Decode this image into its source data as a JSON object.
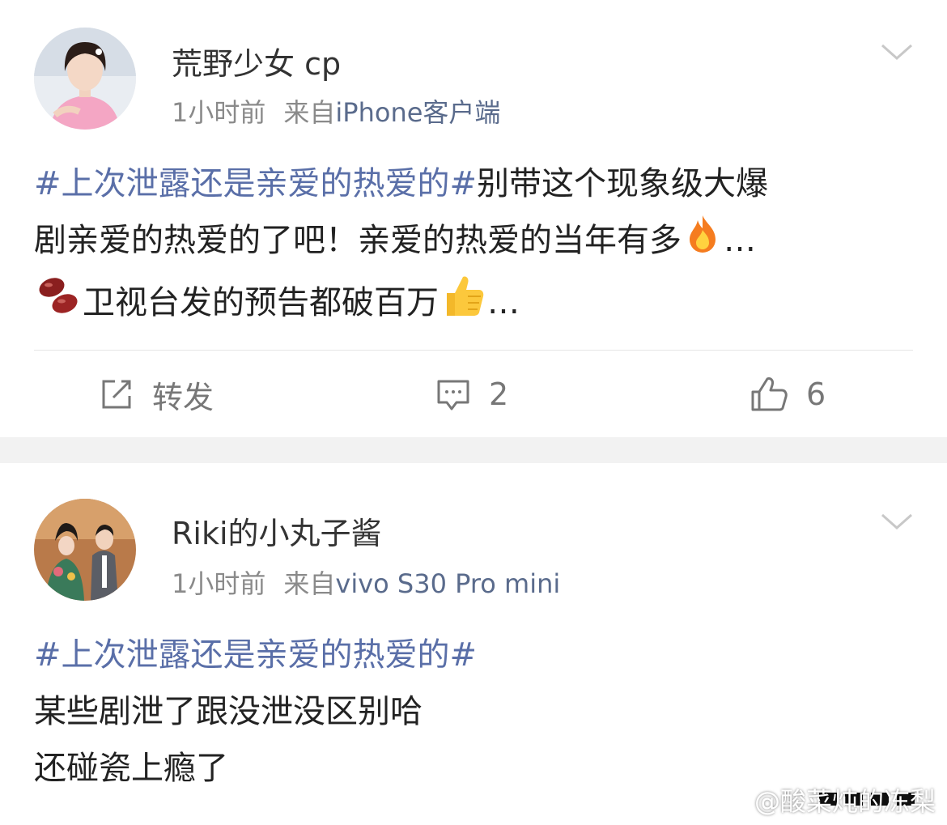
{
  "posts": [
    {
      "username": "荒野少女 cp",
      "time": "1小时前",
      "source_prefix": "来自",
      "source": "iPhone客户端",
      "topic": "#上次泄露还是亲爱的热爱的#",
      "line1_rest": "别带这个现象级大爆",
      "line2": "剧亲爱的热爱的了吧！亲爱的热爱的当年有多",
      "line2_end": "…",
      "line3": "卫视台发的预告都破百万",
      "line3_end": "…",
      "emojis": [
        "fire-icon",
        "beans-icon",
        "thumbs-up-icon"
      ],
      "actions": {
        "repost": "转发",
        "comment_count": "2",
        "like_count": "6"
      }
    },
    {
      "username": "Riki的小丸子酱",
      "time": "1小时前",
      "source_prefix": "来自",
      "source": "vivo S30 Pro mini",
      "topic": "#上次泄露还是亲爱的热爱的#",
      "line2": "某些剧泄了跟没泄没区别哈",
      "line3": "还碰瓷上瘾了"
    }
  ],
  "watermark": "@酸菜炖的冻梨",
  "colors": {
    "topic": "#5a6fa8",
    "source": "#5a6b8c",
    "separator": "#f2f2f2"
  }
}
